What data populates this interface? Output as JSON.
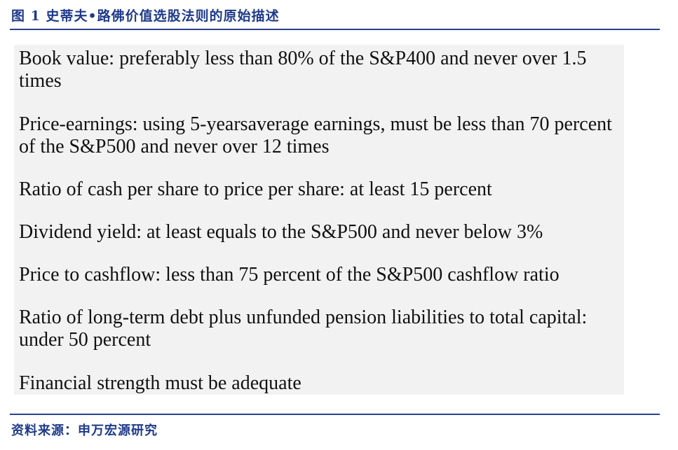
{
  "figure": {
    "title": "图 1 史蒂夫•路佛价值选股法则的原始描述"
  },
  "criteria": [
    "Book value: preferably less than 80% of the S&P400 and never over 1.5 times",
    "Price-earnings: using 5-yearsaverage earnings, must be less than 70 percent of the S&P500 and never over 12 times",
    "Ratio of cash per share to price per share: at least 15 percent",
    "Dividend yield: at least equals to the S&P500 and never below 3%",
    "Price to cashflow: less than 75 percent of the S&P500 cashflow ratio",
    "Ratio of long-term debt plus unfunded pension liabilities to total capital: under 50 percent",
    "Financial strength must be adequate"
  ],
  "source": "资料来源：申万宏源研究",
  "colors": {
    "heading": "#1f3a8a",
    "rule": "#2b3f8c",
    "panel_background": "#f2f2f2",
    "body_text": "#111111"
  }
}
